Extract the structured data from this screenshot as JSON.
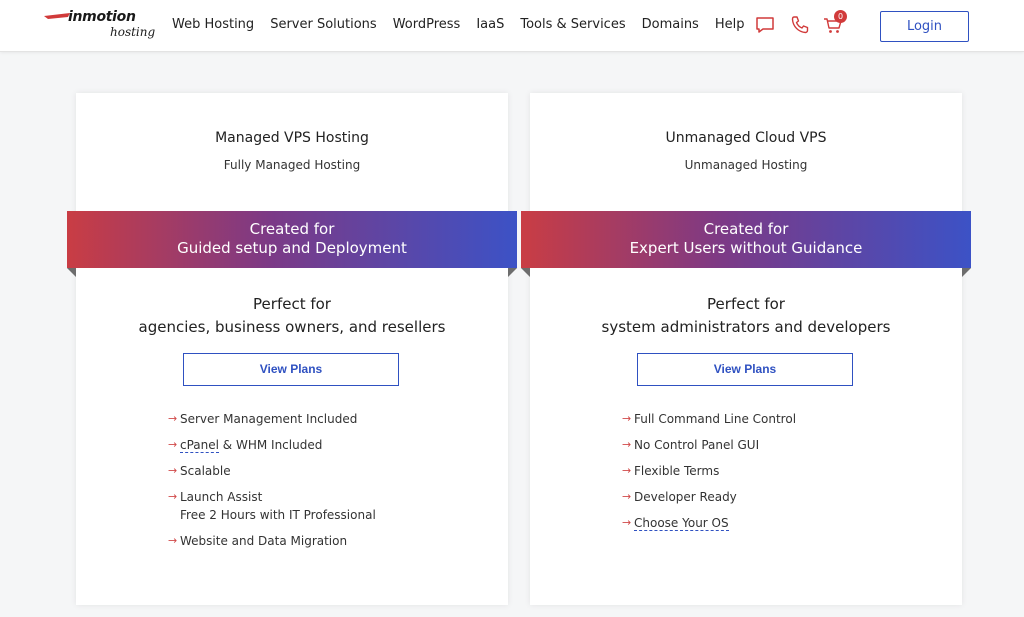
{
  "header": {
    "logo_main": "inmotion",
    "logo_sub": "hosting",
    "nav": [
      "Web Hosting",
      "Server Solutions",
      "WordPress",
      "IaaS",
      "Tools & Services",
      "Domains",
      "Help"
    ],
    "cart_count": "0",
    "login_label": "Login",
    "icons": [
      "chat-icon",
      "phone-icon",
      "cart-icon"
    ]
  },
  "colors": {
    "accent_blue": "#2f51c1",
    "accent_red": "#c93d44",
    "ribbon_gradient": [
      "#c93d44",
      "#7c3a86",
      "#3c52c6"
    ]
  },
  "cards": [
    {
      "title": "Managed VPS Hosting",
      "subtitle": "Fully Managed Hosting",
      "ribbon_line1": "Created for",
      "ribbon_line2": "Guided setup and Deployment",
      "perfect_line1": "Perfect for",
      "perfect_line2": "agencies, business owners, and resellers",
      "button": "View Plans",
      "features": [
        {
          "text": "Server Management Included"
        },
        {
          "linked": "cPanel",
          "rest": " & WHM Included"
        },
        {
          "text": "Scalable"
        },
        {
          "text": "Launch Assist",
          "text2": "Free 2 Hours with IT Professional"
        },
        {
          "text": "Website and Data Migration"
        }
      ]
    },
    {
      "title": "Unmanaged Cloud VPS",
      "subtitle": "Unmanaged Hosting",
      "ribbon_line1": "Created for",
      "ribbon_line2": "Expert Users without Guidance",
      "perfect_line1": "Perfect for",
      "perfect_line2": "system administrators and developers",
      "button": "View Plans",
      "features": [
        {
          "text": "Full Command Line Control"
        },
        {
          "text": "No Control Panel GUI"
        },
        {
          "text": "Flexible Terms"
        },
        {
          "text": "Developer Ready"
        },
        {
          "linked": "Choose Your OS"
        }
      ]
    }
  ]
}
